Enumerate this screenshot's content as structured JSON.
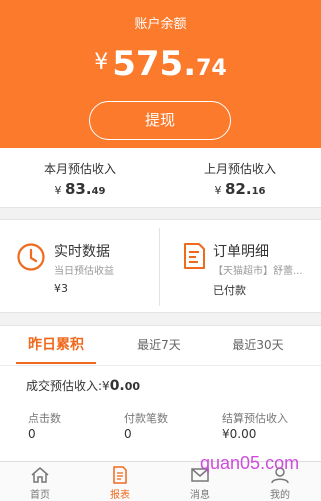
{
  "header": {
    "title": "账户余额",
    "balance": {
      "currency": "¥",
      "integer": "575.",
      "decimal": "74"
    },
    "withdraw_label": "提现",
    "color": "#fb7a2c"
  },
  "month": {
    "this_month": {
      "label": "本月预估收入",
      "currency": "¥",
      "integer": "83.",
      "decimal": "49"
    },
    "last_month": {
      "label": "上月预估收入",
      "currency": "¥",
      "integer": "82.",
      "decimal": "16"
    }
  },
  "cards": {
    "realtime": {
      "icon": "clock-icon",
      "title": "实时数据",
      "subtitle": "当日预估收益",
      "value": "¥3"
    },
    "orders": {
      "icon": "document-icon",
      "title": "订单明细",
      "subtitle": "【天猫超市】舒蕾...",
      "value": "已付款"
    }
  },
  "stats": {
    "tabs": [
      {
        "label": "昨日累积",
        "active": true
      },
      {
        "label": "最近7天",
        "active": false
      },
      {
        "label": "最近30天",
        "active": false
      }
    ],
    "deal": {
      "label": "成交预估收入:",
      "currency": "¥",
      "integer": "0.",
      "decimal": "00"
    },
    "metrics": [
      {
        "label": "点击数",
        "value": "0"
      },
      {
        "label": "付款笔数",
        "value": "0"
      },
      {
        "label": "结算预估收入",
        "value": "¥0.00"
      }
    ]
  },
  "nav": {
    "items": [
      {
        "label": "首页",
        "icon": "home-icon",
        "active": false
      },
      {
        "label": "报表",
        "icon": "report-icon",
        "active": true
      },
      {
        "label": "消息",
        "icon": "message-icon",
        "active": false
      },
      {
        "label": "我的",
        "icon": "user-icon",
        "active": false
      }
    ]
  },
  "watermark": "quan05.com",
  "accent_color": "#f06a1e"
}
